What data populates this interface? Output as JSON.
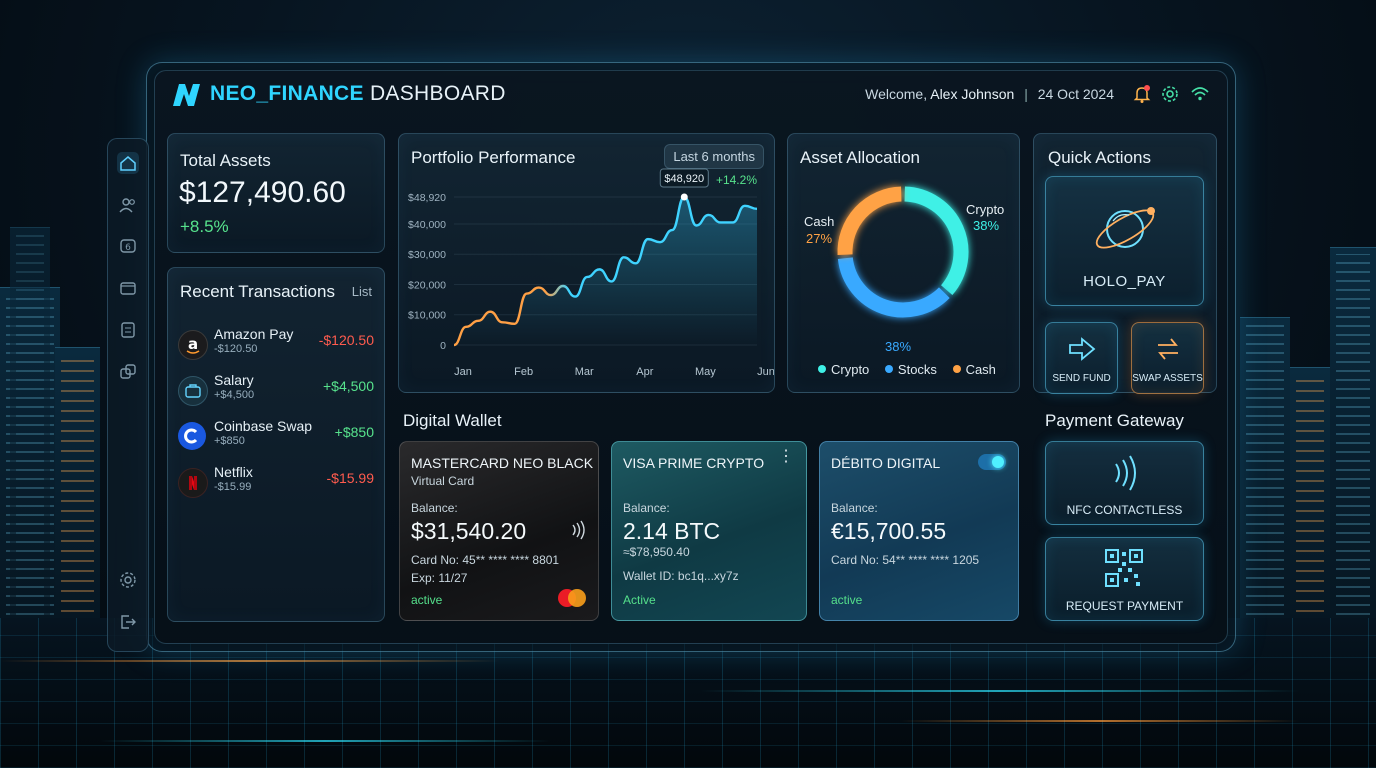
{
  "header": {
    "brand_primary": "NEO_FINANCE",
    "brand_secondary": "DASHBOARD",
    "welcome_prefix": "Welcome,",
    "user_name": "Alex Johnson",
    "separator": "|",
    "date": "24 Oct 2024"
  },
  "total_assets": {
    "title": "Total Assets",
    "value": "$127,490.60",
    "change": "+8.5%"
  },
  "transactions": {
    "title": "Recent Transactions",
    "action": "List",
    "items": [
      {
        "name": "Amazon Pay",
        "sub": "-$120.50",
        "amount": "-$120.50",
        "icon": "amazon-icon"
      },
      {
        "name": "Salary",
        "sub": "+$4,500",
        "amount": "+$4,500",
        "icon": "briefcase-icon"
      },
      {
        "name": "Coinbase Swap",
        "sub": "+$850",
        "amount": "+$850",
        "icon": "coinbase-icon"
      },
      {
        "name": "Netflix",
        "sub": "-$15.99",
        "amount": "-$15.99",
        "icon": "netflix-icon"
      }
    ]
  },
  "portfolio": {
    "title": "Portfolio Performance",
    "range": "Last 6 months",
    "tooltip": "$48,920",
    "change": "+14.2%"
  },
  "chart_data": {
    "type": "line",
    "title": "Portfolio Performance",
    "categories": [
      "Jan",
      "Feb",
      "Mar",
      "Apr",
      "May",
      "Jun"
    ],
    "yticks": [
      "$48,920",
      "$40,000",
      "$30,000",
      "$20,000",
      "$10,000",
      "0"
    ],
    "ylim": [
      0,
      48920
    ],
    "x": [
      0,
      0.2,
      0.4,
      0.6,
      0.8,
      1.0,
      1.2,
      1.4,
      1.6,
      1.8,
      2.0,
      2.2,
      2.4,
      2.6,
      2.8,
      3.0,
      3.2,
      3.4,
      3.6,
      3.8,
      4.0,
      4.2,
      4.4,
      4.6,
      4.8,
      5.0
    ],
    "values": [
      0,
      6000,
      8000,
      11000,
      7500,
      7000,
      17000,
      19000,
      16500,
      19500,
      16000,
      22500,
      25000,
      21000,
      29000,
      27000,
      35000,
      34000,
      38000,
      48920,
      39500,
      43000,
      40500,
      40500,
      46000,
      45000
    ],
    "series_color": "#3fd3ff",
    "grid": true,
    "marker_value": "$48,920",
    "annotation": "+14.2%"
  },
  "allocation": {
    "title": "Asset Allocation",
    "crypto_label": "Crypto",
    "crypto_value": "38%",
    "cash_label": "Cash",
    "cash_value": "27%",
    "stocks_value": "38%",
    "legend": [
      "Crypto",
      "Stocks",
      "Cash"
    ],
    "colors": {
      "crypto": "#3ff0e6",
      "stocks": "#39a9ff",
      "cash": "#ffa245"
    },
    "slices": [
      {
        "name": "Crypto",
        "value": 38
      },
      {
        "name": "Stocks",
        "value": 38
      },
      {
        "name": "Cash",
        "value": 27
      }
    ]
  },
  "quick_actions": {
    "title": "Quick Actions",
    "holo_pay": "HOLO_PAY",
    "send_fund": "SEND FUND",
    "swap_assets": "SWAP ASSETS"
  },
  "wallet": {
    "title": "Digital Wallet",
    "cards": [
      {
        "title": "MASTERCARD NEO BLACK",
        "subtitle": "Virtual Card",
        "balance_label": "Balance:",
        "balance": "$31,540.20",
        "line1": "Card No: 45** **** **** 8801",
        "line2": "Exp: 11/27",
        "status": "active"
      },
      {
        "title": "VISA PRIME CRYPTO",
        "balance_label": "Balance:",
        "balance": "2.14 BTC",
        "line1": "≈$78,950.40",
        "line2": "Wallet ID: bc1q...xy7z",
        "status": "Active"
      },
      {
        "title": "DÉBITO DIGITAL",
        "balance_label": "Balance:",
        "balance": "€15,700.55",
        "line1": "Card No: 54** **** **** 1205",
        "status": "active"
      }
    ]
  },
  "gateway": {
    "title": "Payment Gateway",
    "nfc": "NFC CONTACTLESS",
    "request": "REQUEST PAYMENT"
  }
}
